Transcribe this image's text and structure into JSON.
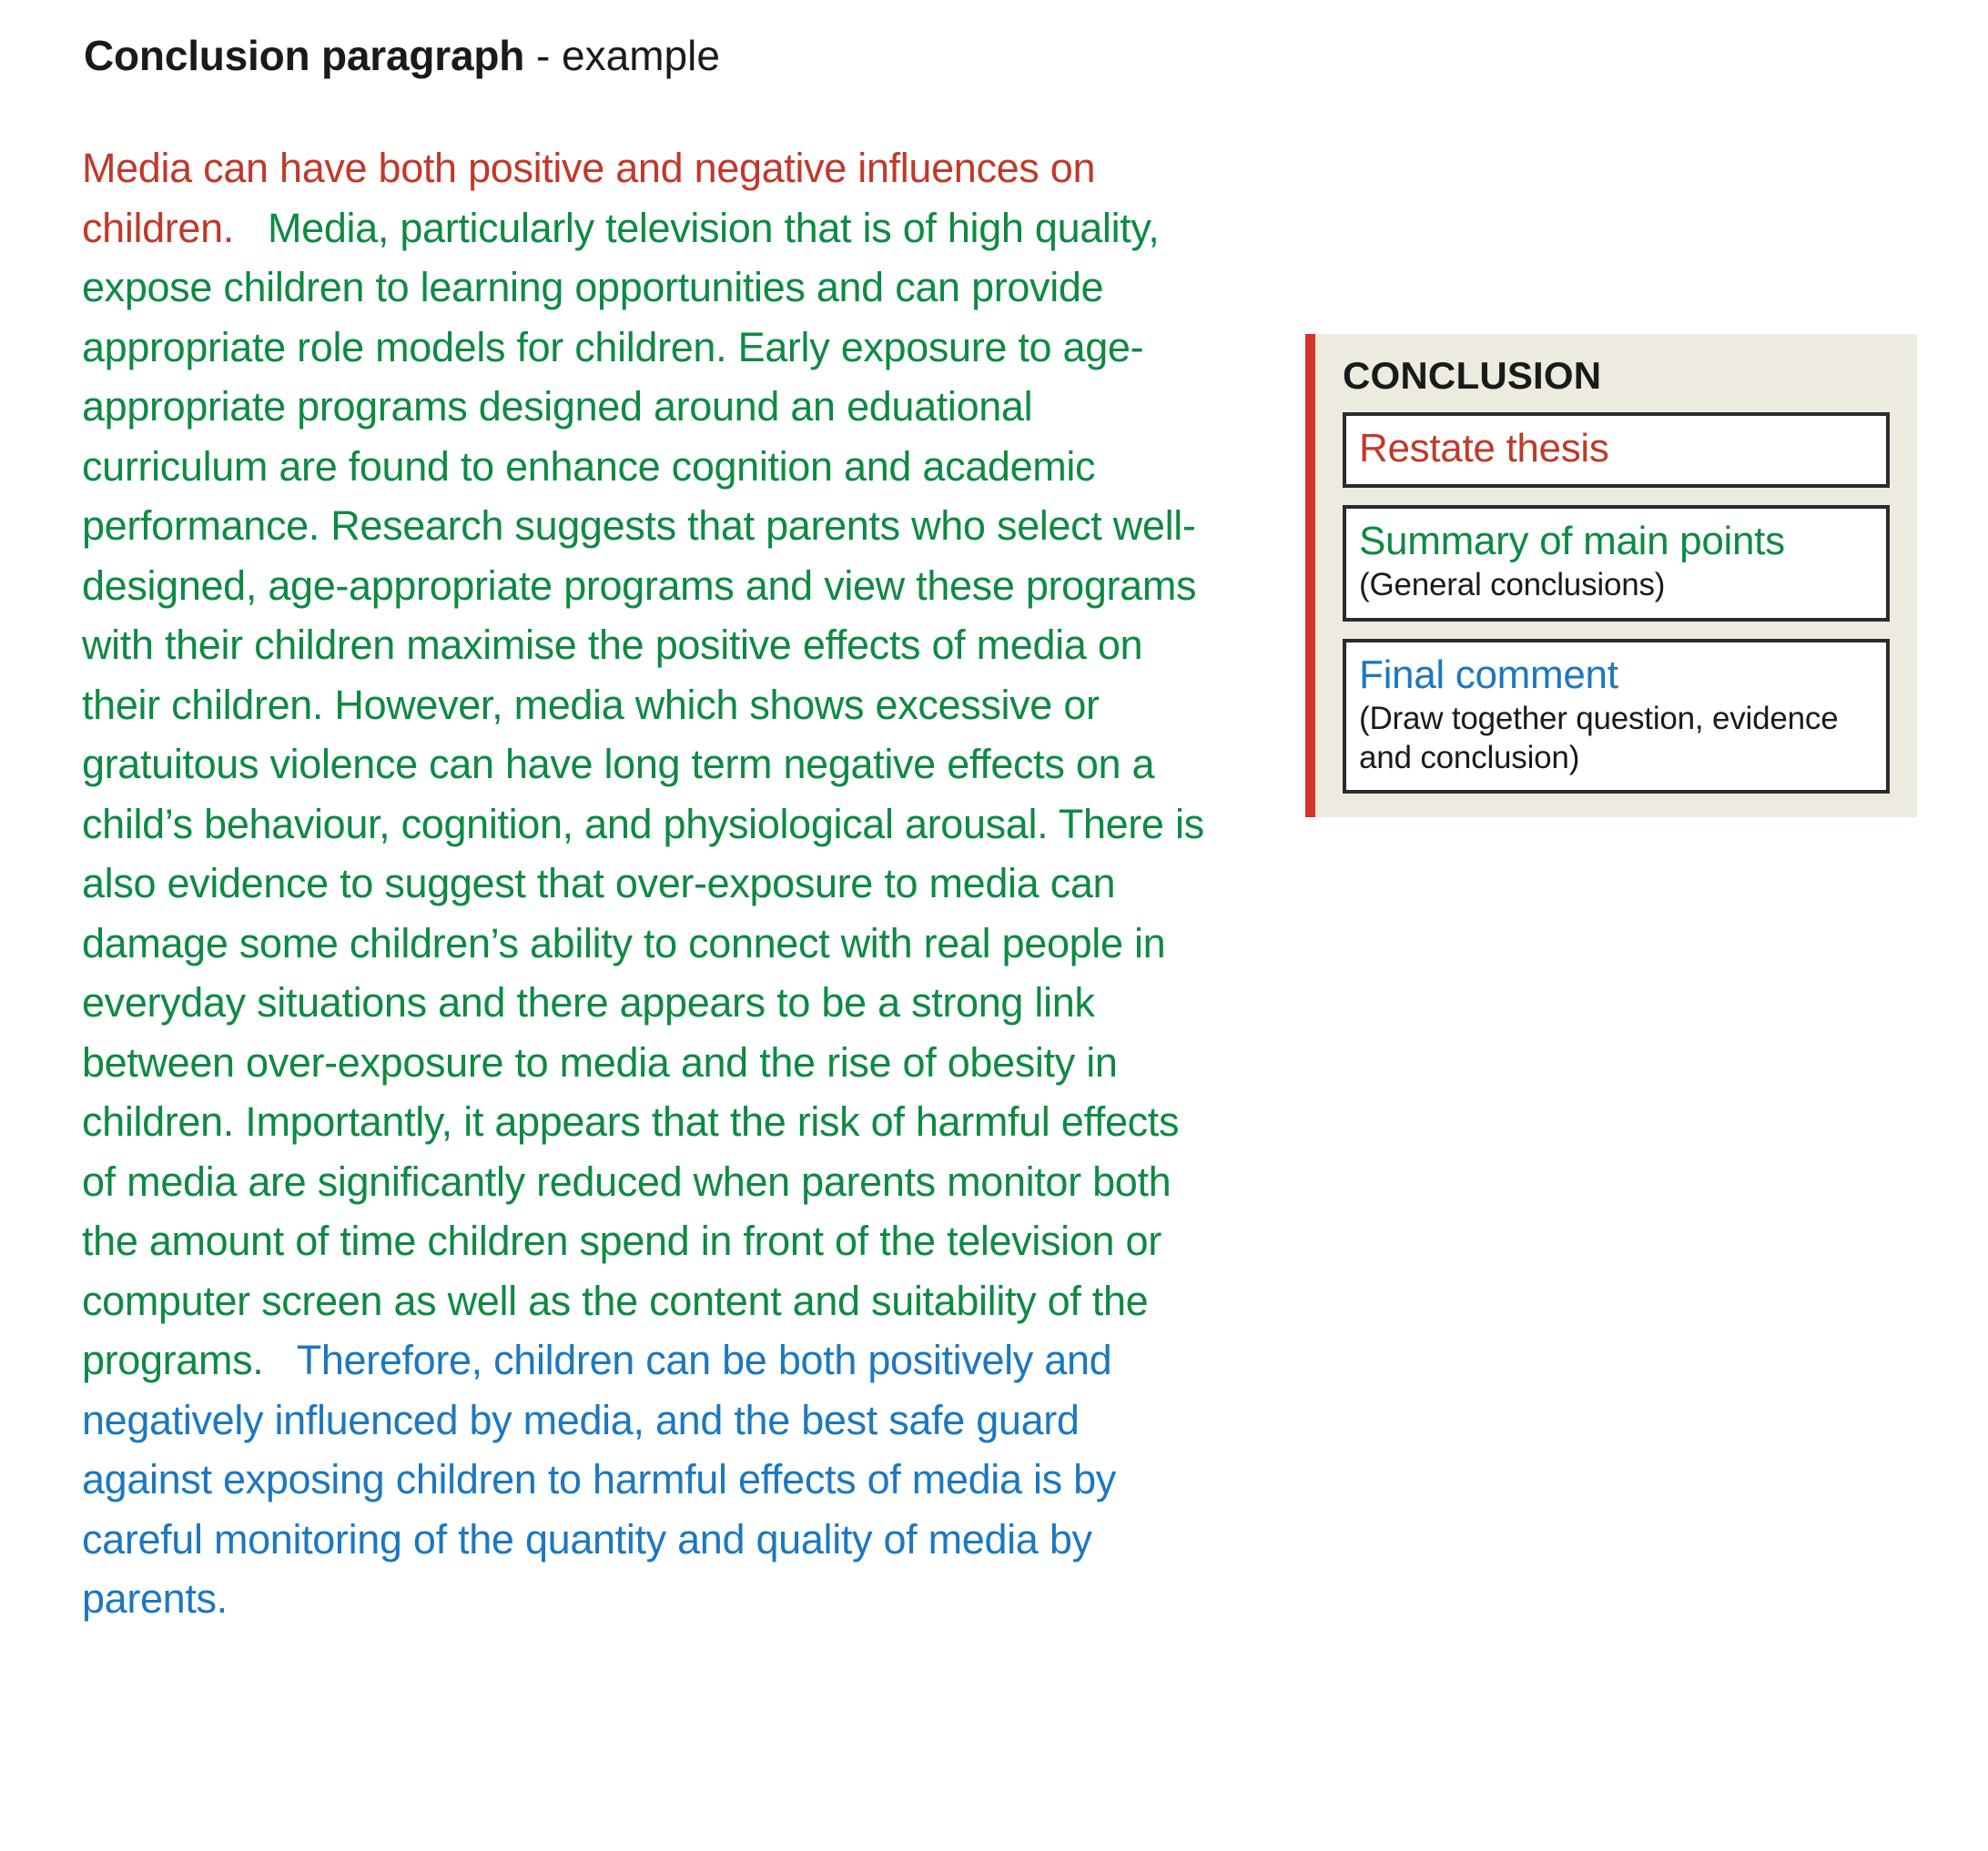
{
  "heading": {
    "main": "Conclusion paragraph",
    "sub": " - example"
  },
  "colors": {
    "red": "#C0392B",
    "green": "#0E8A43",
    "blue": "#1C78C0",
    "callout_background": "#EDEAE0",
    "callout_accent_bar": "#D0342C",
    "box_border": "#2B2B2B",
    "text_black": "#1A1A1A",
    "page_background": "#FFFFFF"
  },
  "paragraph": {
    "restate_thesis": "Media can have both positive and negative influences on children.",
    "summary_of_main_points": "Media, particularly television that is of high quality, expose children to learning opportunities and can provide appropriate role models for children. Early exposure to age-appropriate programs designed around an eduational curriculum are found to enhance cognition and academic performance. Research suggests that parents who select well-designed, age-appropriate programs and view these programs with their children maximise the positive effects of media on their children. However, media which shows excessive or gratuitous violence can have long term negative effects on a child’s behaviour, cognition, and physiological arousal. There is also evidence to suggest that over-exposure to media can damage some children’s ability to connect with real people in everyday situations and there appears to be a strong link between over-exposure to media and the rise of obesity in children. Importantly, it appears that the risk of harmful effects of media are significantly reduced when parents monitor both the amount of time children spend in front of the television or computer screen as well as the content and suitability of the programs.",
    "final_comment": "Therefore, children can be both positively and negatively influenced by media, and the best safe guard against exposing children to harmful effects of media is by careful monitoring of the quantity and quality of media by parents."
  },
  "callout": {
    "title": "CONCLUSION",
    "boxes": [
      {
        "title": "Restate thesis",
        "note": "",
        "color_key": "red"
      },
      {
        "title": "Summary of main points",
        "note": "(General conclusions)",
        "color_key": "green"
      },
      {
        "title": "Final comment",
        "note": "(Draw together question, evidence and conclusion)",
        "color_key": "blue"
      }
    ]
  }
}
